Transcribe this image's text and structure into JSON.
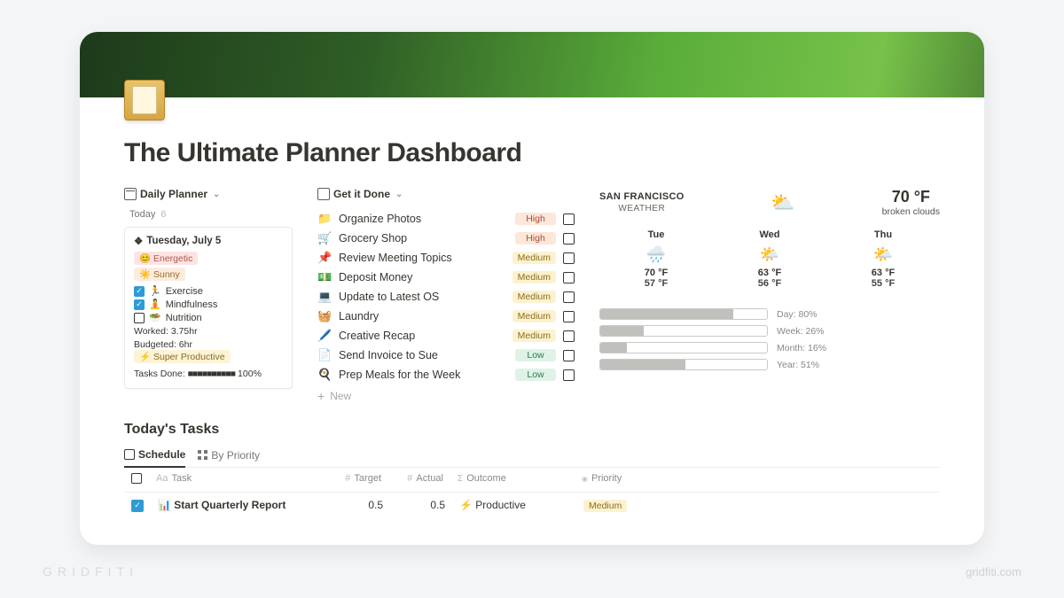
{
  "page_title": "The Ultimate Planner Dashboard",
  "daily_planner": {
    "toggle_label": "Daily Planner",
    "today_label": "Today",
    "today_count": "6",
    "card": {
      "date_icon": "❖",
      "date": "Tuesday, July 5",
      "mood_tag": "😊 Energetic",
      "weather_tag": "☀️ Sunny",
      "habits": [
        {
          "done": true,
          "emoji": "🏃",
          "label": "Exercise"
        },
        {
          "done": true,
          "emoji": "🧘",
          "label": "Mindfulness"
        },
        {
          "done": false,
          "emoji": "🥗",
          "label": "Nutrition"
        }
      ],
      "worked": "Worked: 3.75hr",
      "budgeted": "Budgeted: 6hr",
      "productive": "⚡ Super Productive",
      "tasks_done_label": "Tasks Done:",
      "tasks_done_bars": "■■■■■■■■■■",
      "tasks_done_pct": "100%"
    }
  },
  "get_it_done": {
    "toggle_label": "Get it Done",
    "new_label": "New",
    "tasks": [
      {
        "emoji": "📁",
        "name": "Organize Photos",
        "priority": "High"
      },
      {
        "emoji": "🛒",
        "name": "Grocery Shop",
        "priority": "High"
      },
      {
        "emoji": "📌",
        "name": "Review Meeting Topics",
        "priority": "Medium"
      },
      {
        "emoji": "💵",
        "name": "Deposit Money",
        "priority": "Medium"
      },
      {
        "emoji": "💻",
        "name": "Update to Latest OS",
        "priority": "Medium"
      },
      {
        "emoji": "🧺",
        "name": "Laundry",
        "priority": "Medium"
      },
      {
        "emoji": "🖊️",
        "name": "Creative Recap",
        "priority": "Medium"
      },
      {
        "emoji": "📄",
        "name": "Send Invoice to Sue",
        "priority": "Low"
      },
      {
        "emoji": "🍳",
        "name": "Prep Meals for the Week",
        "priority": "Low"
      }
    ]
  },
  "weather": {
    "location": "SAN FRANCISCO",
    "location_sub": "WEATHER",
    "now_icon": "⛅",
    "now_temp": "70 °F",
    "now_desc": "broken clouds",
    "forecast": [
      {
        "day": "Tue",
        "icon": "🌧️",
        "hi": "70 °F",
        "lo": "57 °F"
      },
      {
        "day": "Wed",
        "icon": "🌤️",
        "hi": "63 °F",
        "lo": "56 °F"
      },
      {
        "day": "Thu",
        "icon": "🌤️",
        "hi": "63 °F",
        "lo": "55 °F"
      }
    ]
  },
  "progress": [
    {
      "label": "Day: 80%",
      "pct": 80
    },
    {
      "label": "Week: 26%",
      "pct": 26
    },
    {
      "label": "Month: 16%",
      "pct": 16
    },
    {
      "label": "Year: 51%",
      "pct": 51
    }
  ],
  "todays_tasks": {
    "heading": "Today's Tasks",
    "tabs": [
      {
        "label": "Schedule",
        "active": true
      },
      {
        "label": "By Priority",
        "active": false
      }
    ],
    "columns": {
      "task": "Task",
      "target": "Target",
      "actual": "Actual",
      "outcome": "Outcome",
      "priority": "Priority"
    },
    "rows": [
      {
        "done": true,
        "emoji": "📊",
        "task": "Start Quarterly Report",
        "target": "0.5",
        "actual": "0.5",
        "outcome_icon": "⚡",
        "outcome": "Productive",
        "priority": "Medium"
      }
    ]
  },
  "watermark": {
    "brand": "GRIDFITI",
    "url": "gridfiti.com"
  }
}
